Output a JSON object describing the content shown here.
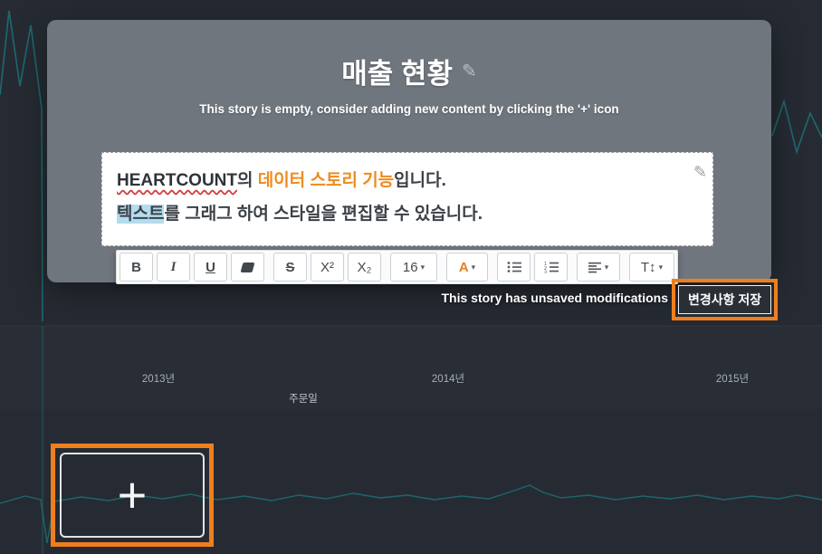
{
  "modal": {
    "title": "매출 현황",
    "subtitle": "This story is empty, consider adding new content by clicking the '+' icon",
    "editor": {
      "brand": "HEARTCOUNT",
      "after_brand": "의 ",
      "feature": "데이터 스토리 기능",
      "line1_end": "입니다.",
      "selected": "텍스트",
      "line2_end": "를 그래그 하여 스타일을 편집할 수 있습니다."
    }
  },
  "toolbar": {
    "bold": "B",
    "italic": "I",
    "underline": "U",
    "strikethrough": "S",
    "superscript": "X²",
    "subscript": "X₂",
    "font_size": "16",
    "font_color_letter": "A",
    "line_height": "T↕"
  },
  "icons": {
    "edit_pencil": "✎",
    "caret_down": "▾"
  },
  "status": {
    "message": "This story has unsaved modifications",
    "save_button_label": "변경사항 저장"
  },
  "chart_background": {
    "x_tick_labels": [
      "2013년",
      "2014년",
      "2015년"
    ],
    "x_axis_title": "주문일",
    "line_color": "#1d7078"
  },
  "add_button": {
    "label": "+"
  },
  "colors": {
    "annotation_orange": "#ef7f1e",
    "feature_text_orange": "#ee8b1e",
    "selection_blue": "#b3dced",
    "modal_gray": "#70767e",
    "background_dark": "#262b33"
  }
}
